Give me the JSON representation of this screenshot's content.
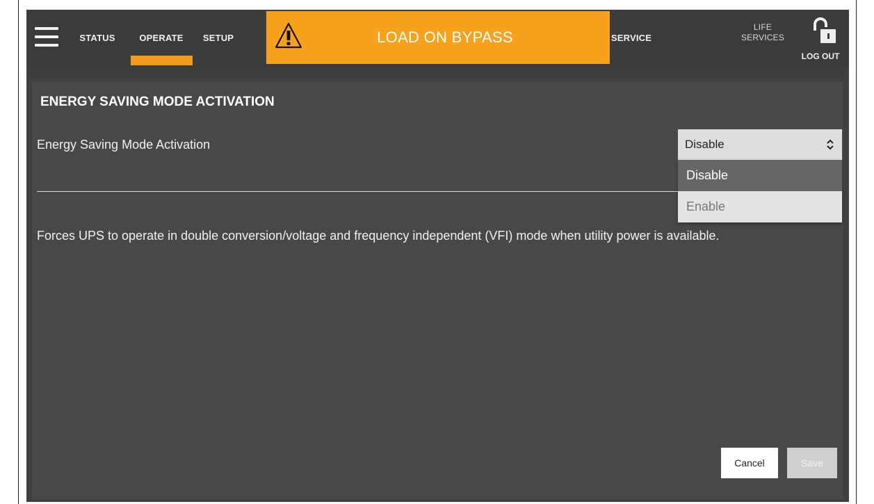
{
  "nav": {
    "tabs": [
      {
        "label": "STATUS"
      },
      {
        "label": "OPERATE",
        "active": true
      },
      {
        "label": "SETUP"
      }
    ],
    "alarm": {
      "text": "LOAD ON BYPASS",
      "icon": "warning-triangle-icon",
      "color": "#f7a11d"
    },
    "service_label": "SERVICE",
    "life_services_line1": "LIFE",
    "life_services_line2": "SERVICES",
    "logout_label": "LOG OUT",
    "accent_color": "#f39a1f"
  },
  "panel": {
    "title": "ENERGY SAVING MODE ACTIVATION",
    "setting_label": "Energy Saving Mode Activation",
    "select": {
      "value": "Disable",
      "options": [
        "Disable",
        "Enable"
      ]
    },
    "description": "Forces UPS to operate in double conversion/voltage and frequency independent (VFI) mode when utility power is available.",
    "cancel_label": "Cancel",
    "save_label": "Save"
  }
}
